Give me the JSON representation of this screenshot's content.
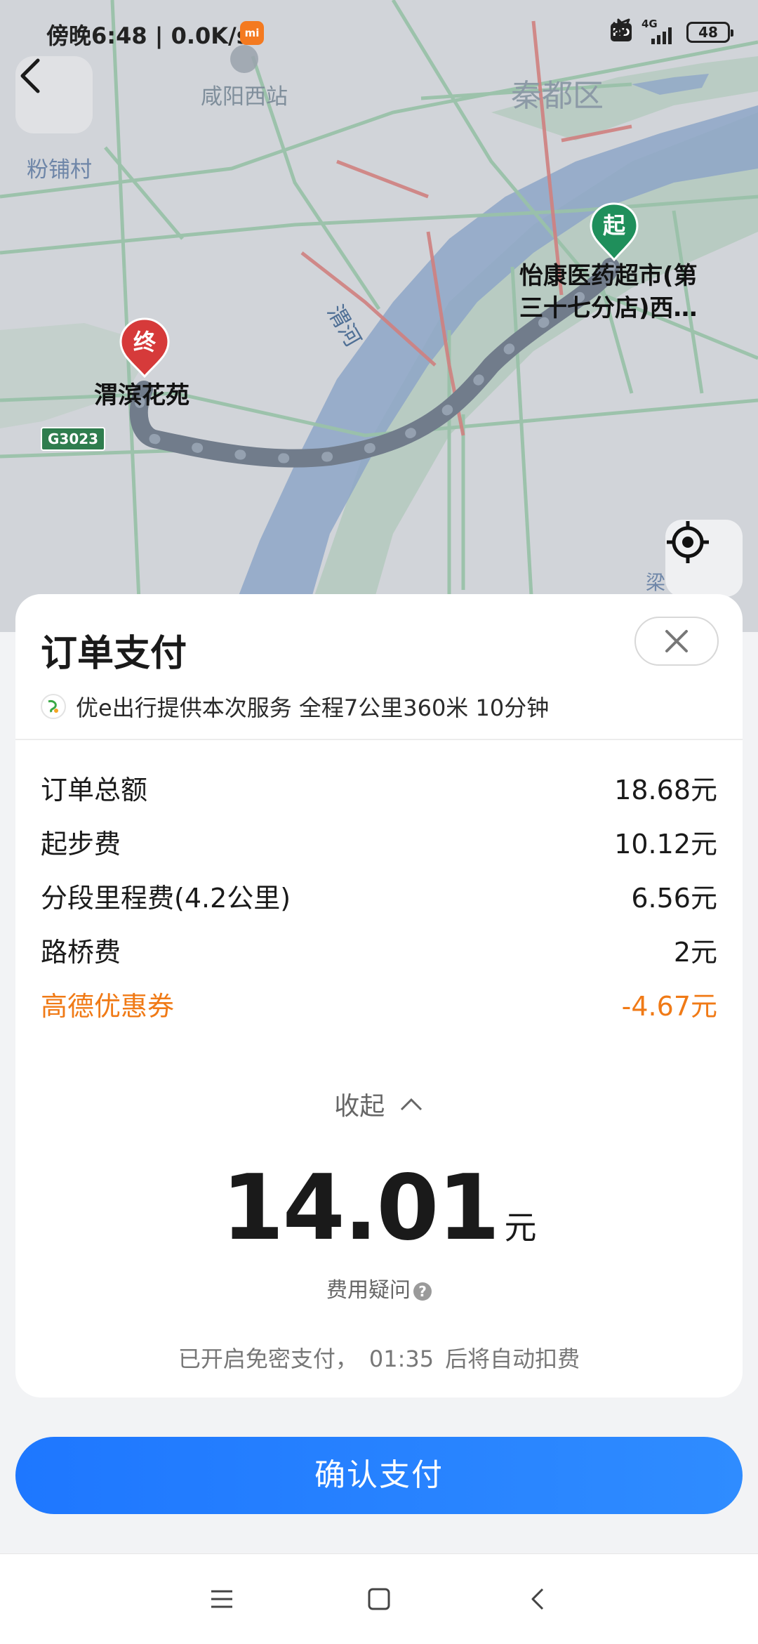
{
  "status_bar": {
    "time": "傍晚6:48 | 0.0K/s",
    "hd": "HD",
    "network": "4G",
    "battery": "48"
  },
  "map": {
    "labels": {
      "station": "咸阳西站",
      "district": "秦都区",
      "village": "粉铺村",
      "river": "渭河",
      "road_badge": "G3023",
      "edge_right": "梁"
    },
    "start": {
      "marker": "起",
      "name_line1": "怡康医药超市(第",
      "name_line2": "三十七分店)西…"
    },
    "end": {
      "marker": "终",
      "name": "渭滨花苑"
    },
    "colors": {
      "route": "#5f6f80",
      "start_pin": "#1f8f5b",
      "end_pin": "#d63a3a"
    }
  },
  "panel": {
    "title": "订单支付",
    "service": "优e出行提供本次服务 全程7公里360米 10分钟",
    "fees": [
      {
        "label": "订单总额",
        "value": "18.68元"
      },
      {
        "label": "起步费",
        "value": "10.12元"
      },
      {
        "label": "分段里程费(4.2公里)",
        "value": "6.56元"
      },
      {
        "label": "路桥费",
        "value": "2元"
      },
      {
        "label": "高德优惠券",
        "value": "-4.67元"
      }
    ],
    "collapse_label": "收起",
    "total_amount": "14.01",
    "total_unit": "元",
    "fee_question": "费用疑问",
    "autopay_prefix": "已开启免密支付，",
    "autopay_countdown": "01:35",
    "autopay_suffix": "后将自动扣费",
    "coupon_color": "#f07a16"
  },
  "pay_button": "确认支付"
}
